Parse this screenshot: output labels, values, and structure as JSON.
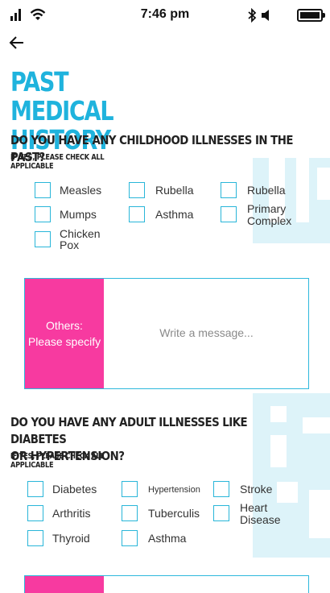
{
  "status_bar": {
    "time": "7:46 pm"
  },
  "page": {
    "title_line1": "PAST MEDICAL",
    "title_line2": "HISTORY"
  },
  "section1": {
    "question": "DO YOU HAVE ANY CHILDHOOD ILLNESSES IN THE PAST?",
    "hint": "IF YES, PLEASE CHECK ALL APPLICABLE",
    "options": [
      "Measles",
      "Rubella",
      "Rubella",
      "Mumps",
      "Asthma",
      "Primary",
      "Complex",
      "Chicken",
      "Pox"
    ],
    "others_label_1": "Others:",
    "others_label_2": "Please specify",
    "others_placeholder": "Write a message..."
  },
  "section2": {
    "question_line1": "DO YOU HAVE ANY ADULT ILLNESSES LIKE DIABETES",
    "question_line2": "OR HYPERTENSION?",
    "hint": "IF YES, PLEASE CHECK ALL APPLICABLE",
    "options": [
      "Diabetes",
      "Hypertension",
      "Stroke",
      "Arthritis",
      "Tuberculis",
      "Heart",
      "Disease",
      "Thyroid",
      "Asthma"
    ]
  },
  "colors": {
    "accent": "#1fb3dd",
    "pink": "#f73aa0",
    "deco": "#ddf3f9"
  }
}
